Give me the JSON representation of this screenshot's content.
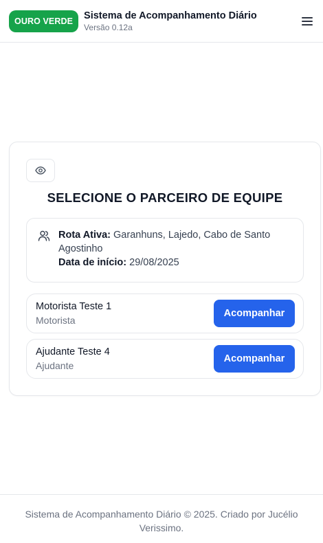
{
  "header": {
    "badge": "OURO VERDE",
    "title": "Sistema de Acompanhamento Diário",
    "version": "Versão 0.12a",
    "menu_icon": "hamburger-menu-icon"
  },
  "card": {
    "toggle_icon": "eye-icon",
    "title": "SELECIONE O PARCEIRO DE EQUIPE",
    "route": {
      "icon": "users-icon",
      "active_label": "Rota Ativa:",
      "active_value": "Garanhuns, Lajedo, Cabo de Santo Agostinho",
      "start_label": "Data de início:",
      "start_value": "29/08/2025"
    },
    "members": [
      {
        "name": "Motorista Teste 1",
        "role": "Motorista",
        "action": "Acompanhar"
      },
      {
        "name": "Ajudante Teste 4",
        "role": "Ajudante",
        "action": "Acompanhar"
      }
    ]
  },
  "footer": {
    "text": "Sistema de Acompanhamento Diário © 2025. Criado por Jucélio Verissimo."
  },
  "colors": {
    "brand_green": "#16a34a",
    "primary_blue": "#2563eb",
    "border": "#e5e7eb",
    "muted_text": "#6b7280"
  }
}
